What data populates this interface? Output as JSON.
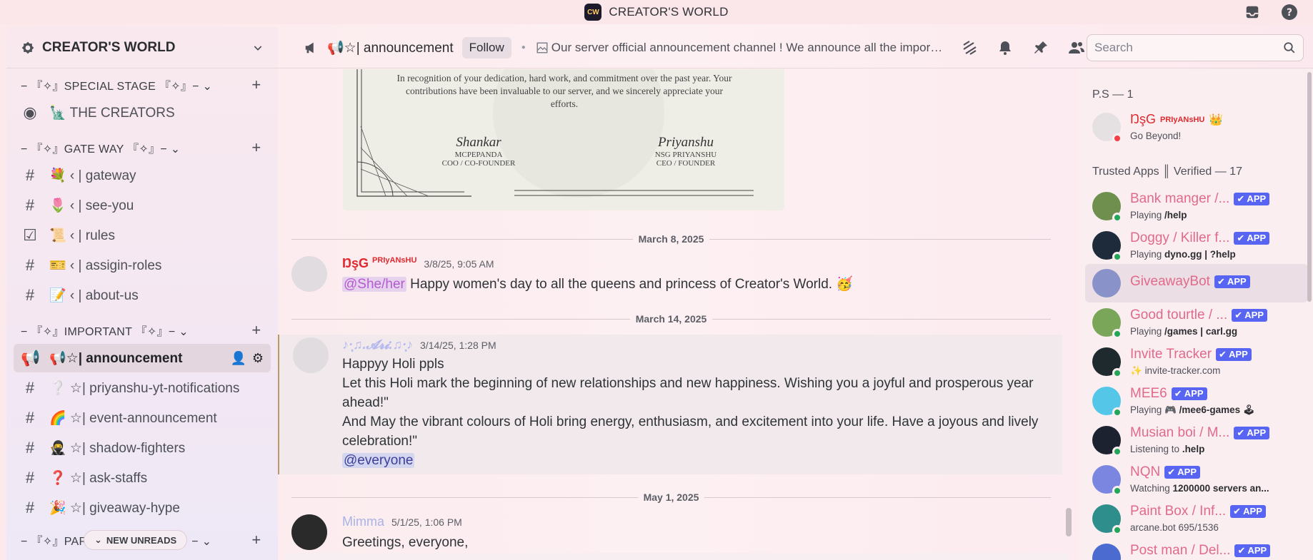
{
  "window": {
    "title": "CREATOR'S WORLD",
    "logo_text": "CW"
  },
  "sidebar": {
    "server_name": "CREATOR'S WORLD",
    "categories": [
      {
        "label": "− 『✧』SPECIAL STAGE 『✧』− ⌄"
      },
      {
        "label": "− 『✧』GATE WAY 『✧』− ⌄"
      },
      {
        "label": "− 『✧』IMPORTANT 『✧』− ⌄"
      },
      {
        "label": "− 『✧』PARTNERS HUB 『✧』− ⌄"
      }
    ],
    "channels": [
      {
        "icon": "◉",
        "name": "🗽 THE CREATORS"
      },
      {
        "icon": "#",
        "name": "💐 ‹ | gateway"
      },
      {
        "icon": "#",
        "name": "🌷 ‹ | see-you"
      },
      {
        "icon": "☑",
        "name": "📜 ‹ | rules"
      },
      {
        "icon": "#",
        "name": "🎫 ‹ | assigin-roles"
      },
      {
        "icon": "#",
        "name": "📝 ‹ | about-us"
      },
      {
        "icon": "📢",
        "name": "📢☆| announcement"
      },
      {
        "icon": "#",
        "name": "❔ ☆| priyanshu-yt-notifications"
      },
      {
        "icon": "#",
        "name": "🌈 ☆| event-announcement"
      },
      {
        "icon": "#",
        "name": "🥷 ☆| shadow-fighters"
      },
      {
        "icon": "#",
        "name": "❓ ☆| ask-staffs"
      },
      {
        "icon": "#",
        "name": "🎉 ☆| giveaway-hype"
      }
    ],
    "new_unreads": "NEW UNREADS"
  },
  "header": {
    "channel_name": "📢☆| announcement",
    "follow_label": "Follow",
    "topic": "Our server official announcement channel ! We announce all the important news here.",
    "search_placeholder": "Search"
  },
  "certificate": {
    "text": "In recognition of your dedication, hard work, and commitment over the past year. Your contributions have been invaluable to our server, and we sincerely appreciate your efforts.",
    "signers": [
      {
        "signature": "Shankar",
        "name": "MCPEPANDA",
        "role": "COO / CO-FOUNDER"
      },
      {
        "signature": "Priyanshu",
        "name": "NSG PRIYANSHU",
        "role": "CEO / FOUNDER"
      }
    ]
  },
  "messages": {
    "dividers": [
      "March 8, 2025",
      "March 14, 2025",
      "May 1, 2025"
    ],
    "items": [
      {
        "author": "ŊşG",
        "tag": "PRIyANsHU",
        "timestamp": "3/8/25, 9:05 AM",
        "mention": "@She/her",
        "text": "Happy women's day to all the queens and princess of Creator's World. 🥳",
        "color": "#e0282e"
      },
      {
        "author": "♪·̩͙♫.𝓐𝓻𝓲.♫·̩͙♪",
        "timestamp": "3/14/25, 1:28 PM",
        "lines": [
          "Happyy Holi ppls",
          "Let this Holi mark the beginning of new relationships and new happiness. Wishing you a joyful and prosperous year ahead!\"",
          "And May the vibrant colours of Holi bring energy, enthusiasm, and excitement into your life. Have a joyous and lively celebration!\""
        ],
        "mention": "@everyone",
        "color": "#b4b8ee"
      },
      {
        "author": "Mimma",
        "timestamp": "5/1/25, 1:06 PM",
        "text": "Greetings, everyone,",
        "color": "#a9b3e6"
      }
    ]
  },
  "members": {
    "owner_section": "P.S — 1",
    "owner": {
      "name": "ŊşG",
      "tag": "PRIyANsHU",
      "crown": "👑",
      "activity": "Go Beyond!"
    },
    "apps_section": "Trusted Apps ║ Verified — 17",
    "app_badge": "✔ APP",
    "apps": [
      {
        "name": "Bank manger /...",
        "activity_prefix": "Playing ",
        "activity": "/help",
        "avatar_color": "#6f8f4e"
      },
      {
        "name": "Doggy / Killer f...",
        "activity_prefix": "Playing ",
        "activity": "dyno.gg | ?help",
        "avatar_color": "#1d2b3a"
      },
      {
        "name": "GiveawayBot",
        "activity_prefix": "",
        "activity": "",
        "avatar_color": "#8a93c9"
      },
      {
        "name": "Good tourtle / ...",
        "activity_prefix": "Playing ",
        "activity": "/games | carl.gg",
        "avatar_color": "#7aa65a"
      },
      {
        "name": "Invite Tracker",
        "activity_prefix": "✨ ",
        "activity": "invite-tracker.com",
        "avatar_color": "#1f2a2f"
      },
      {
        "name": "MEE6",
        "activity_prefix": "Playing 🎮 ",
        "activity": "/mee6-games 🕹",
        "avatar_color": "#54c6e8"
      },
      {
        "name": "Musian boi / M...",
        "activity_prefix": "Listening to ",
        "activity": ".help",
        "avatar_color": "#1c2230"
      },
      {
        "name": "NQN",
        "activity_prefix": "Watching ",
        "activity": "1200000 servers an...",
        "avatar_color": "#7b86e0"
      },
      {
        "name": "Paint Box / Inf...",
        "activity_prefix": "",
        "activity": "arcane.bot 695/1536",
        "avatar_color": "#2e8e8b"
      },
      {
        "name": "Post man / Del...",
        "activity_prefix": "",
        "activity": "",
        "avatar_color": "#4c6bd0"
      }
    ]
  }
}
